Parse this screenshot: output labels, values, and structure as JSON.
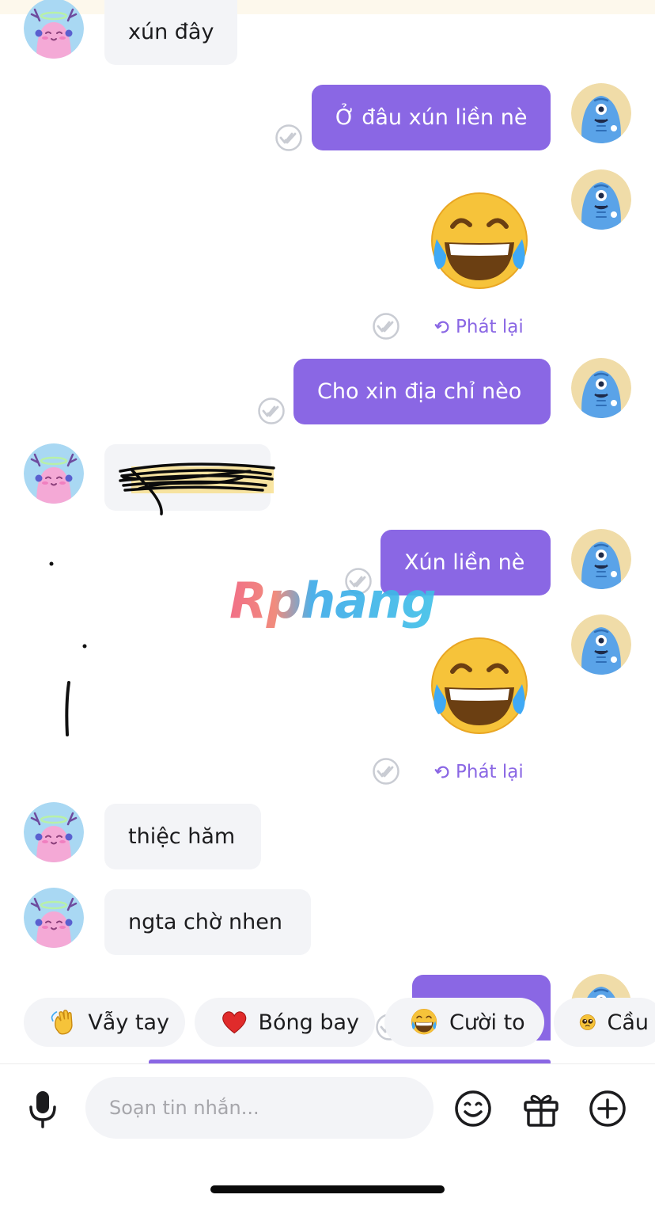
{
  "messages": {
    "in_1": "xún đây",
    "out_1": "Ở đâu xún liền nè",
    "out_2": "Cho xin địa chỉ nèo",
    "out_3": "Xún liền nè",
    "in_3": "thiệc hăm",
    "in_4": "ngta chờ nhen"
  },
  "replay_label": "Phát lại",
  "watermark": "Rphang",
  "chips": [
    {
      "icon": "waving-hand-emoji",
      "label": "Vẫy tay"
    },
    {
      "icon": "heart-emoji",
      "label": "Bóng bay"
    },
    {
      "icon": "laughing-tears-emoji",
      "label": "Cười to"
    },
    {
      "icon": "pleading-face-emoji",
      "label": "Cầu"
    }
  ],
  "composer": {
    "placeholder": "Soạn tin nhắn...",
    "mic_icon": "mic-icon",
    "emoji_icon": "smiley-icon",
    "gift_icon": "gift-icon",
    "add_icon": "plus-circle-icon"
  },
  "colors": {
    "accent": "#8a67e4",
    "incoming_bubble": "#f3f4f7",
    "read_tick": "#c9ccd3"
  }
}
